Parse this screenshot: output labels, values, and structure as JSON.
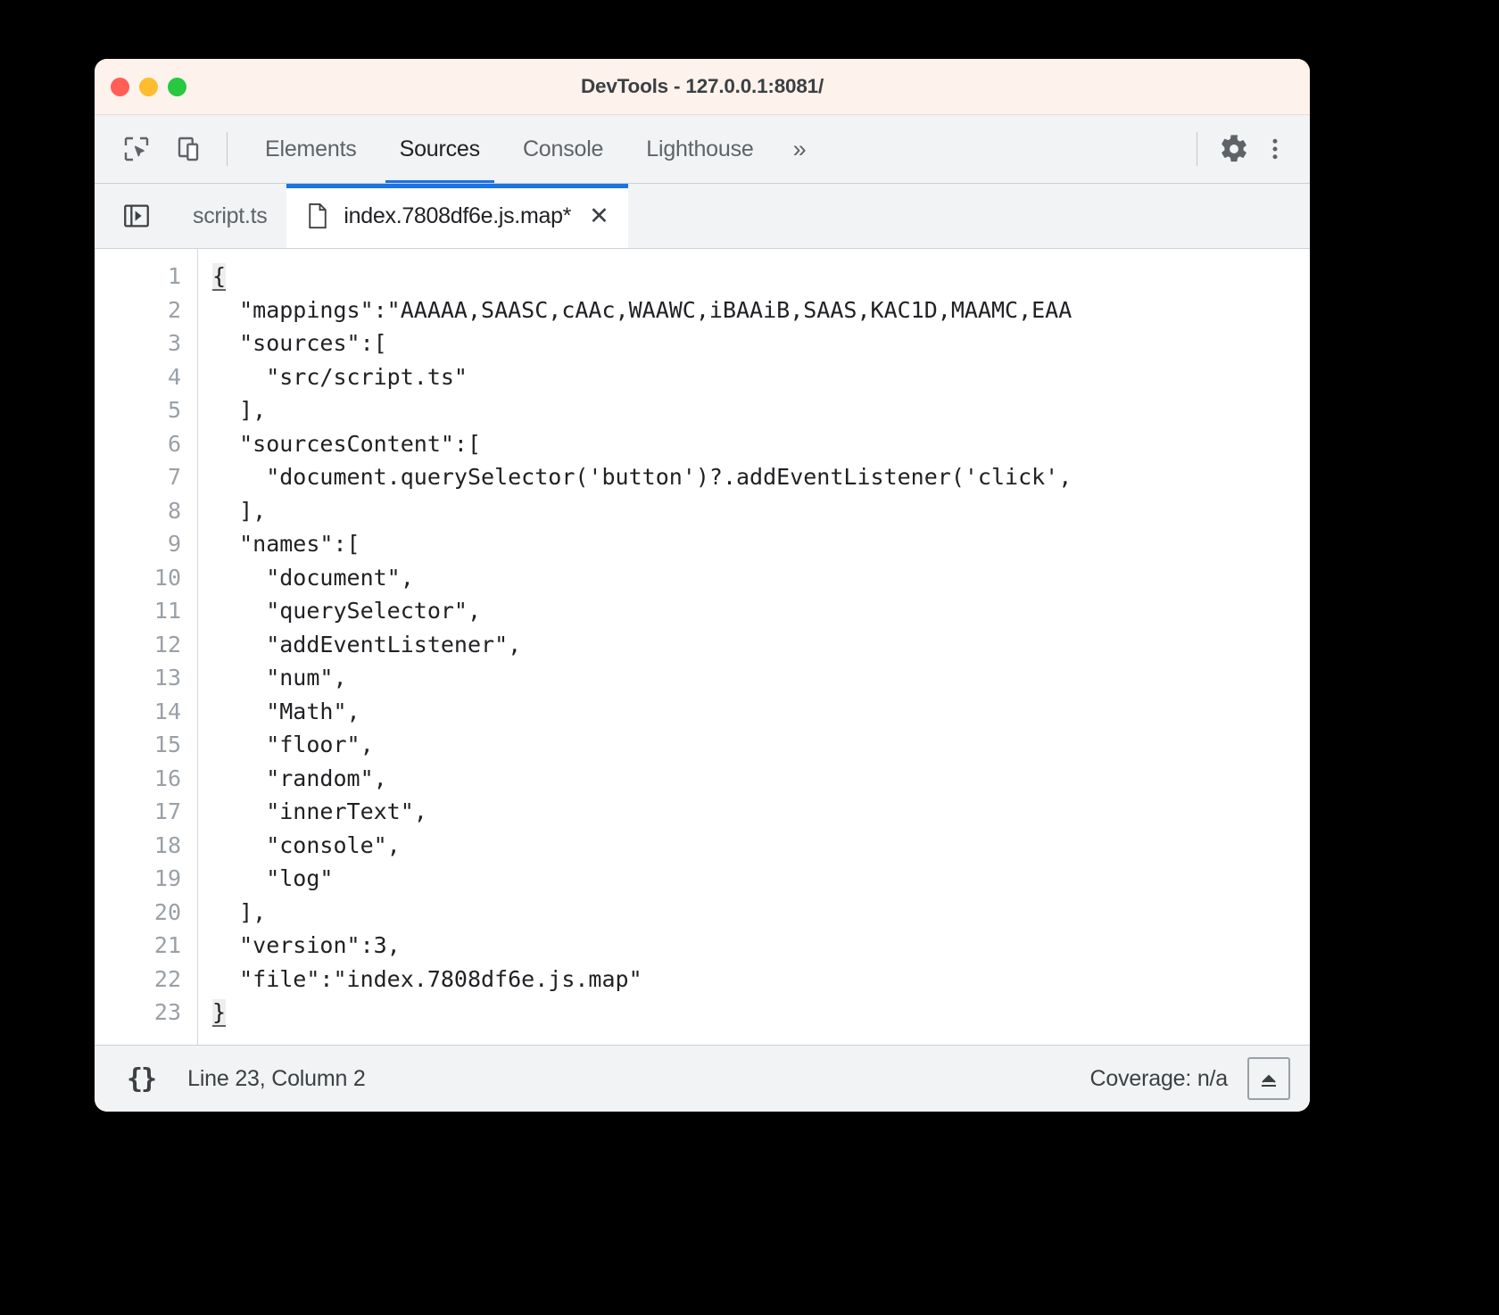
{
  "window": {
    "title": "DevTools - 127.0.0.1:8081/",
    "traffic_lights": [
      {
        "name": "close",
        "color": "#ff5f57"
      },
      {
        "name": "minimize",
        "color": "#febc2e"
      },
      {
        "name": "zoom",
        "color": "#28c840"
      }
    ]
  },
  "toolbar": {
    "inspect_icon": "inspect-element-icon",
    "device_icon": "device-toolbar-icon",
    "tabs": [
      {
        "label": "Elements",
        "active": false
      },
      {
        "label": "Sources",
        "active": true
      },
      {
        "label": "Console",
        "active": false
      },
      {
        "label": "Lighthouse",
        "active": false
      }
    ],
    "overflow_label": "»",
    "settings_icon": "gear-icon",
    "more_icon": "more-vertical-icon"
  },
  "filebar": {
    "navigator_icon": "show-navigator-icon",
    "tabs": [
      {
        "label": "script.ts",
        "active": false,
        "has_icon": false,
        "closable": false
      },
      {
        "label": "index.7808df6e.js.map*",
        "active": true,
        "has_icon": true,
        "closable": true,
        "close_label": "✕"
      }
    ]
  },
  "editor": {
    "line_numbers": [
      "1",
      "2",
      "3",
      "4",
      "5",
      "6",
      "7",
      "8",
      "9",
      "10",
      "11",
      "12",
      "13",
      "14",
      "15",
      "16",
      "17",
      "18",
      "19",
      "20",
      "21",
      "22",
      "23"
    ],
    "lines": [
      "{",
      "  \"mappings\":\"AAAAA,SAASC,cAAc,WAAWC,iBAAiB,SAAS,KAC1D,MAAMC,EAA",
      "  \"sources\":[",
      "    \"src/script.ts\"",
      "  ],",
      "  \"sourcesContent\":[",
      "    \"document.querySelector('button')?.addEventListener('click',",
      "  ],",
      "  \"names\":[",
      "    \"document\",",
      "    \"querySelector\",",
      "    \"addEventListener\",",
      "    \"num\",",
      "    \"Math\",",
      "    \"floor\",",
      "    \"random\",",
      "    \"innerText\",",
      "    \"console\",",
      "    \"log\"",
      "  ],",
      "  \"version\":3,",
      "  \"file\":\"index.7808df6e.js.map\"",
      "}"
    ],
    "first_brace": "{",
    "last_brace": "}"
  },
  "statusbar": {
    "pretty_print_label": "{}",
    "position": "Line 23, Column 2",
    "coverage": "Coverage: n/a",
    "popout_icon": "show-drawer-icon"
  },
  "colors": {
    "accent": "#1a73e8",
    "titlebar_bg": "#fdf2ec",
    "toolbar_bg": "#f1f3f4",
    "editor_bg": "#ffffff",
    "text": "#202124",
    "muted_text": "#5f6368",
    "gutter_text": "#9aa0a6"
  }
}
